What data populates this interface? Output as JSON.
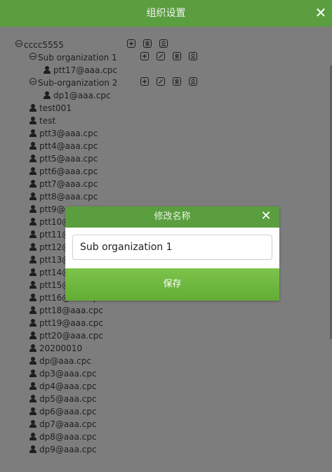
{
  "header": {
    "title": "组织设置",
    "close_label": "✕"
  },
  "tree": {
    "root": {
      "label": "cccc5555"
    },
    "sub1": {
      "label": "Sub organization 1",
      "member": "ptt17@aaa.cpc"
    },
    "sub2": {
      "label": "Sub-organization 2",
      "member": "dp1@aaa.cpc"
    },
    "members": [
      "test001",
      "test",
      "ptt3@aaa.cpc",
      "ptt4@aaa.cpc",
      "ptt5@aaa.cpc",
      "ptt6@aaa.cpc",
      "ptt7@aaa.cpc",
      "ptt8@aaa.cpc",
      "ptt9@aaa.cpc",
      "ptt10@aaa.cpc",
      "ptt11@aaa.cpc",
      "ptt12@aaa.cpc",
      "ptt13@aaa.cpc",
      "ptt14@aaa.cpc",
      "ptt15@aaa.cpc",
      "ptt16@aaa.cpc",
      "ptt18@aaa.cpc",
      "ptt19@aaa.cpc",
      "ptt20@aaa.cpc",
      "20200010",
      "dp@aaa.cpc",
      "dp3@aaa.cpc",
      "dp4@aaa.cpc",
      "dp5@aaa.cpc",
      "dp6@aaa.cpc",
      "dp7@aaa.cpc",
      "dp8@aaa.cpc",
      "dp9@aaa.cpc"
    ]
  },
  "dialog": {
    "title": "修改名称",
    "close_label": "✕",
    "input_value": "Sub organization 1",
    "save_label": "保存"
  }
}
